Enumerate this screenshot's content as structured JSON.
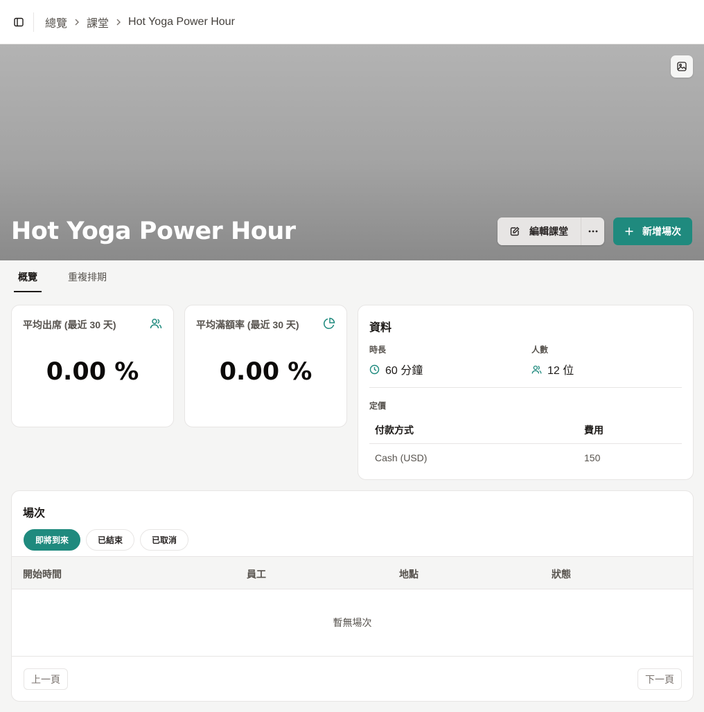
{
  "breadcrumb": {
    "overview": "總覽",
    "classes": "課堂",
    "current": "Hot Yoga Power Hour"
  },
  "hero": {
    "title": "Hot Yoga Power Hour",
    "edit_label": "編輯課堂",
    "add_label": "新增場次"
  },
  "tabs": [
    {
      "label": "概覽",
      "active": true
    },
    {
      "label": "重複排期",
      "active": false
    }
  ],
  "stats": [
    {
      "label": "平均出席 (最近 30 天)",
      "value": "0.00 %",
      "icon": "users-icon"
    },
    {
      "label": "平均滿額率 (最近 30 天)",
      "value": "0.00 %",
      "icon": "pie-chart-icon"
    }
  ],
  "info": {
    "title": "資料",
    "duration_label": "時長",
    "duration_value": "60 分鐘",
    "capacity_label": "人數",
    "capacity_value": "12 位",
    "pricing_label": "定價",
    "pricing_headers": [
      "付款方式",
      "費用"
    ],
    "pricing_rows": [
      [
        "Cash (USD)",
        "150"
      ]
    ]
  },
  "sessions": {
    "title": "場次",
    "filters": [
      {
        "label": "即將到來",
        "active": true
      },
      {
        "label": "已結束",
        "active": false
      },
      {
        "label": "已取消",
        "active": false
      }
    ],
    "columns": [
      "開始時間",
      "員工",
      "地點",
      "狀態"
    ],
    "empty_text": "暫無場次",
    "prev_label": "上一頁",
    "next_label": "下一頁"
  },
  "colors": {
    "accent": "#1f8a7e",
    "page_bg": "#f5f5f4",
    "card_border": "#e7e5e4"
  }
}
